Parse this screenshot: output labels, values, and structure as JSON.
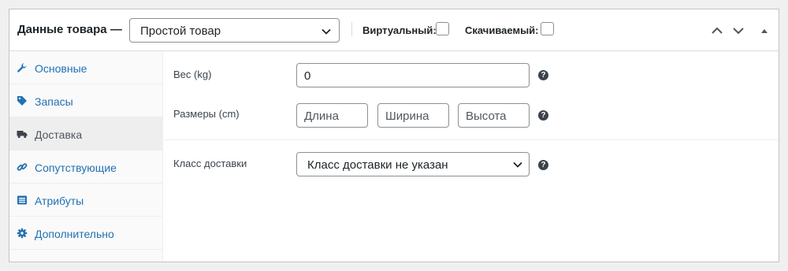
{
  "header": {
    "title": "Данные товара —",
    "product_type": "Простой товар",
    "virtual_label": "Виртуальный:",
    "downloadable_label": "Скачиваемый:",
    "virtual_checked": false,
    "downloadable_checked": false
  },
  "tabs": [
    {
      "label": "Основные",
      "icon": "wrench-icon"
    },
    {
      "label": "Запасы",
      "icon": "tag-icon"
    },
    {
      "label": "Доставка",
      "icon": "truck-icon",
      "active": true
    },
    {
      "label": "Сопутствующие",
      "icon": "link-icon"
    },
    {
      "label": "Атрибуты",
      "icon": "list-icon"
    },
    {
      "label": "Дополнительно",
      "icon": "gear-icon"
    }
  ],
  "shipping": {
    "weight_label": "Вес (kg)",
    "weight_value": "0",
    "dimensions_label": "Размеры (cm)",
    "length_placeholder": "Длина",
    "width_placeholder": "Ширина",
    "height_placeholder": "Высота",
    "class_label": "Класс доставки",
    "class_value": "Класс доставки не указан",
    "help_glyph": "?"
  },
  "colors": {
    "link": "#2271b1",
    "active_tab_bg": "#eeeeee",
    "border": "#8c8f94"
  }
}
